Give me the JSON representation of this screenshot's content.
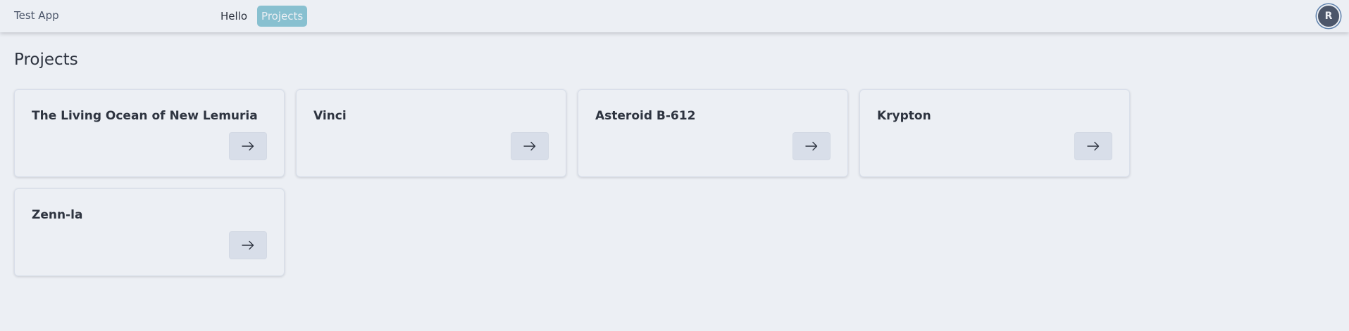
{
  "header": {
    "app_title": "Test App",
    "nav": [
      {
        "label": "Hello",
        "active": false
      },
      {
        "label": "Projects",
        "active": true
      }
    ],
    "avatar_initial": "R"
  },
  "page": {
    "title": "Projects"
  },
  "projects": [
    {
      "name": "The Living Ocean of New Lemuria",
      "action_icon": "arrow-right-icon"
    },
    {
      "name": "Vinci",
      "action_icon": "arrow-right-icon"
    },
    {
      "name": "Asteroid B-612",
      "action_icon": "arrow-right-icon"
    },
    {
      "name": "Krypton",
      "action_icon": "arrow-right-icon"
    },
    {
      "name": "Zenn-la",
      "action_icon": "arrow-right-icon"
    }
  ],
  "colors": {
    "background": "#eceff4",
    "accent": "#88c0d0",
    "text": "#2e3440",
    "button_bg": "#d8dee9",
    "avatar_bg": "#4c566a"
  }
}
